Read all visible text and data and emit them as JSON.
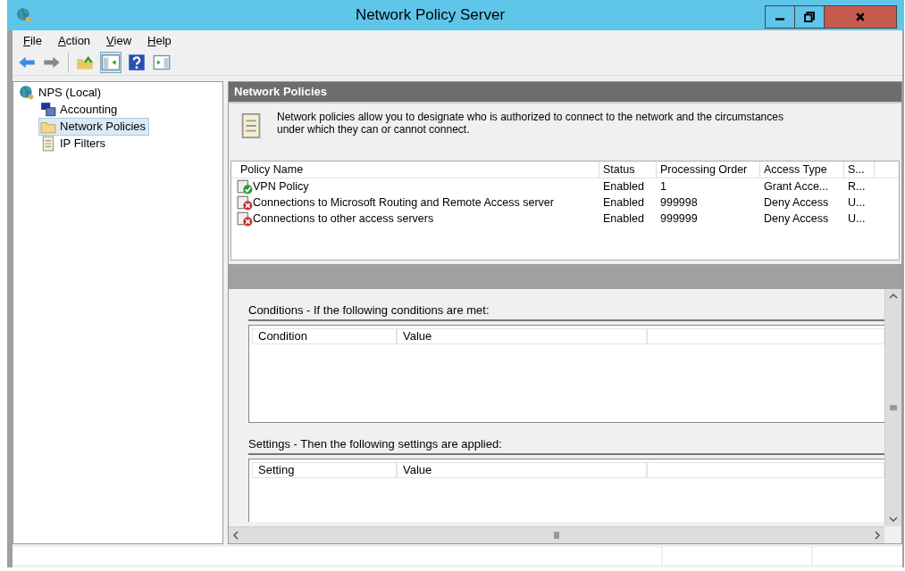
{
  "window": {
    "title": "Network Policy Server"
  },
  "menu": [
    "File",
    "Action",
    "View",
    "Help"
  ],
  "tree": [
    {
      "label": "NPS (Local)",
      "kind": "globe",
      "selected": false,
      "children": [
        {
          "label": "Accounting",
          "kind": "computer",
          "selected": false
        },
        {
          "label": "Network Policies",
          "kind": "folder",
          "selected": true
        },
        {
          "label": "IP Filters",
          "kind": "scroll",
          "selected": false
        }
      ]
    }
  ],
  "panel": {
    "title": "Network Policies",
    "description": "Network policies allow you to designate who is authorized to connect to the network and the circumstances under which they can or cannot connect."
  },
  "policies": {
    "columns": [
      "Policy Name",
      "Status",
      "Processing Order",
      "Access Type",
      "S..."
    ],
    "rows": [
      {
        "kind": "grant",
        "cells": [
          "VPN Policy",
          "Enabled",
          "1",
          "Grant Acce...",
          "R..."
        ]
      },
      {
        "kind": "deny",
        "cells": [
          "Connections to Microsoft Routing and Remote Access server",
          "Enabled",
          "999998",
          "Deny Access",
          "U..."
        ]
      },
      {
        "kind": "deny",
        "cells": [
          "Connections to other access servers",
          "Enabled",
          "999999",
          "Deny Access",
          "U..."
        ]
      }
    ]
  },
  "details": [
    {
      "heading": "Conditions - If the following conditions are met:",
      "columns": [
        "Condition",
        "Value"
      ]
    },
    {
      "heading": "Settings - Then the following settings are applied:",
      "columns": [
        "Setting",
        "Value"
      ]
    }
  ]
}
